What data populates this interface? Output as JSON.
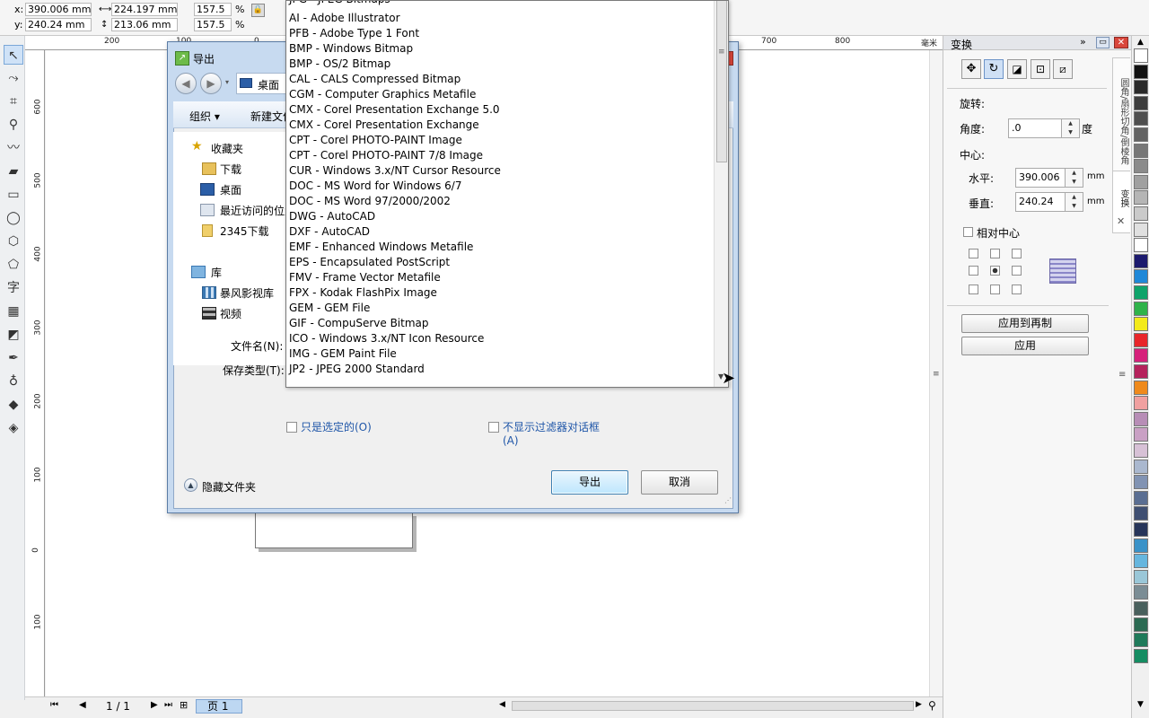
{
  "propbar": {
    "x_label": "x:",
    "x_value": "390.006 mm",
    "y_label": "y:",
    "y_value": "240.24 mm",
    "w_value": "224.197 mm",
    "h_value": "213.06 mm",
    "scale_w": "157.5",
    "scale_h": "157.5",
    "pct1": "%",
    "pct2": "%"
  },
  "hruler": {
    "ticks": [
      "200",
      "100",
      "0",
      "700",
      "800",
      "毫米"
    ]
  },
  "vruler": {
    "ticks": [
      "600",
      "500",
      "400",
      "300",
      "200",
      "100",
      "0",
      "100"
    ]
  },
  "bottombar": {
    "page_count": "1 / 1",
    "page_tab": "页 1"
  },
  "docker": {
    "title": "变换",
    "rotate_label": "旋转:",
    "angle_label": "角度:",
    "angle_value": ".0",
    "angle_unit": "度",
    "center_label": "中心:",
    "horiz_label": "水平:",
    "horiz_value": "390.006",
    "horiz_unit": "mm",
    "vert_label": "垂直:",
    "vert_value": "240.24",
    "vert_unit": "mm",
    "relative_center": "相对中心",
    "apply_copy": "应用到再制",
    "apply": "应用",
    "side_tabs": [
      "圆角/扇形切角/倒棱角",
      "变换"
    ]
  },
  "dialog": {
    "title": "导出",
    "location": "桌面",
    "organize": "组织 ▾",
    "new_folder": "新建文件夹",
    "nav": {
      "favorites": "收藏夹",
      "items": [
        "下载",
        "桌面",
        "最近访问的位置",
        "2345下载"
      ],
      "library": "库",
      "lib_items": [
        "暴风影视库",
        "视频"
      ]
    },
    "filename_label": "文件名(N):",
    "savetype_label": "保存类型(T):",
    "only_selected": "只是选定的(O)",
    "no_filter_dialog": "不显示过滤器对话框",
    "no_filter_dialog_key": "(A)",
    "hide_folders": "隐藏文件夹",
    "export_btn": "导出",
    "cancel_btn": "取消"
  },
  "file_types": [
    "JPG - JPEG Bitmaps",
    "AI - Adobe Illustrator",
    "PFB - Adobe Type 1 Font",
    "BMP - Windows Bitmap",
    "BMP - OS/2 Bitmap",
    "CAL - CALS Compressed Bitmap",
    "CGM - Computer Graphics Metafile",
    "CMX - Corel Presentation Exchange 5.0",
    "CMX - Corel Presentation Exchange",
    "CPT - Corel PHOTO-PAINT Image",
    "CPT - Corel PHOTO-PAINT 7/8 Image",
    "CUR - Windows 3.x/NT Cursor Resource",
    "DOC - MS Word for Windows 6/7",
    "DOC - MS Word 97/2000/2002",
    "DWG - AutoCAD",
    "DXF - AutoCAD",
    "EMF - Enhanced Windows Metafile",
    "EPS - Encapsulated PostScript",
    "FMV - Frame Vector Metafile",
    "FPX - Kodak FlashPix Image",
    "GEM - GEM File",
    "GIF - CompuServe Bitmap",
    "ICO - Windows 3.x/NT Icon Resource",
    "IMG - GEM Paint File",
    "JP2 - JPEG 2000 Standard"
  ],
  "palette": [
    "#ffffff",
    "#111111",
    "#2a2a2a",
    "#3d3d3d",
    "#4f4f4f",
    "#636363",
    "#777777",
    "#8b8b8b",
    "#a0a0a0",
    "#b5b5b5",
    "#cacaca",
    "#e0e0e0",
    "#ffffff",
    "#1c1a6e",
    "#1f88d8",
    "#0fa36a",
    "#2fb34a",
    "#f3ea1a",
    "#e8262a",
    "#d6207b",
    "#b5225c",
    "#ef8a1c",
    "#f0a0a0",
    "#b78db6",
    "#c9a0c4",
    "#d7c1d6",
    "#aab8cf",
    "#8193b3",
    "#5a6e92",
    "#3f4f72",
    "#27355a",
    "#3a92c8",
    "#66b6de",
    "#9ac7d8",
    "#7b8d95",
    "#49605d",
    "#2b6a52",
    "#1f7a5a",
    "#158d62"
  ]
}
